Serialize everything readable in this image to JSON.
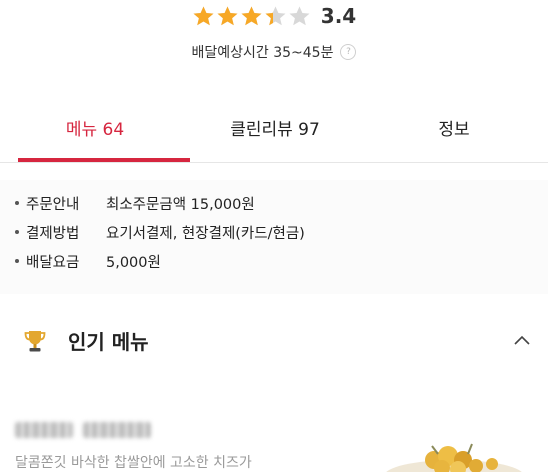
{
  "rating": {
    "value_text": "3.4",
    "stars_filled": 3.4,
    "stars_total": 5,
    "star_color": "#f7a826",
    "star_empty_color": "#d8d8d8"
  },
  "delivery": {
    "label": "배달예상시간 35~45분",
    "help_glyph": "?"
  },
  "tabs": [
    {
      "label": "메뉴 64",
      "active": true
    },
    {
      "label": "클린리뷰 97",
      "active": false
    },
    {
      "label": "정보",
      "active": false
    }
  ],
  "accent_color": "#d6263f",
  "store_info": [
    {
      "key": "주문안내",
      "value": "최소주문금액 15,000원"
    },
    {
      "key": "결제방법",
      "value": "요기서결제, 현장결제(카드/현금)"
    },
    {
      "key": "배달요금",
      "value": "5,000원"
    }
  ],
  "popular": {
    "title": "인기 메뉴",
    "icon": "trophy-icon",
    "toggle_icon": "chevron-up-icon"
  },
  "menu_item": {
    "description": "달콤쫀깃 바삭한 찹쌀안에 고소한 치즈가"
  }
}
